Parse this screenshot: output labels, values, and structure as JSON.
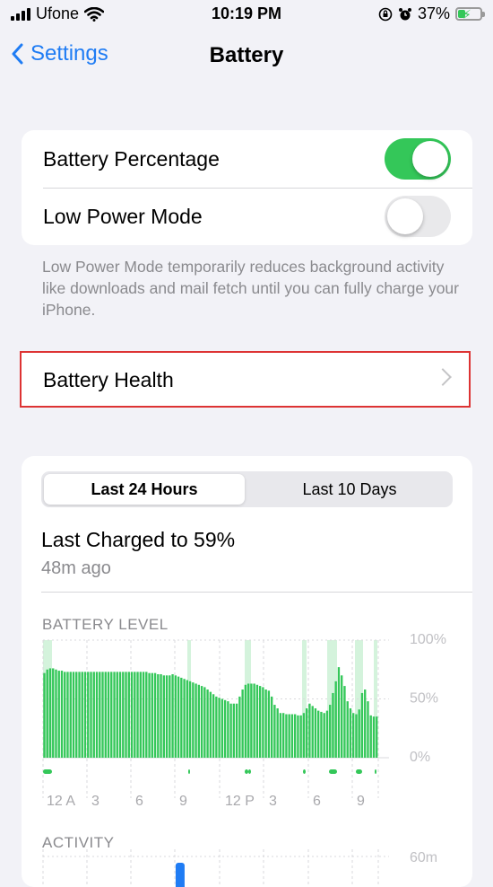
{
  "status": {
    "carrier": "Ufone",
    "time": "10:19 PM",
    "battery_pct": "37%"
  },
  "nav": {
    "back_label": "Settings",
    "title": "Battery"
  },
  "settings": {
    "battery_percentage": {
      "label": "Battery Percentage",
      "on": true
    },
    "low_power_mode": {
      "label": "Low Power Mode",
      "on": false
    },
    "footnote": "Low Power Mode temporarily reduces background activity like downloads and mail fetch until you can fully charge your iPhone."
  },
  "battery_health": {
    "label": "Battery Health"
  },
  "usage": {
    "tabs": [
      "Last 24 Hours",
      "Last 10 Days"
    ],
    "selected_tab": 0,
    "last_charged": "Last Charged to 59%",
    "last_charged_ago": "48m ago",
    "battery_level_title": "BATTERY LEVEL",
    "activity_title": "ACTIVITY",
    "activity_top_label": "60m"
  },
  "colors": {
    "accent": "#1f7cf4",
    "green": "#34c759",
    "charging_band": "#d4f3dc"
  },
  "chart_data": [
    {
      "type": "bar",
      "title": "BATTERY LEVEL",
      "ylabel": "",
      "ylim": [
        0,
        100
      ],
      "y_ticks": [
        "100%",
        "50%",
        "0%"
      ],
      "x_tick_labels": [
        "12 A",
        "3",
        "6",
        "9",
        "12 P",
        "3",
        "6",
        "9"
      ],
      "grid": true,
      "series": [
        {
          "values": [
            72,
            75,
            76,
            76,
            75,
            74,
            74,
            73,
            73,
            73,
            73,
            73,
            73,
            73,
            73,
            73,
            73,
            73,
            73,
            73,
            73,
            73,
            73,
            73,
            73,
            73,
            73,
            73,
            73,
            73,
            73,
            73,
            73,
            73,
            73,
            73,
            72,
            72,
            72,
            71,
            71,
            70,
            70,
            70,
            71,
            70,
            69,
            68,
            67,
            66,
            65,
            64,
            63,
            62,
            61,
            60,
            58,
            56,
            54,
            52,
            51,
            50,
            49,
            48,
            46,
            46,
            46,
            52,
            58,
            62,
            63,
            63,
            63,
            62,
            61,
            60,
            58,
            57,
            52,
            45,
            42,
            38,
            38,
            37,
            37,
            37,
            37,
            36,
            36,
            38,
            42,
            46,
            44,
            42,
            40,
            39,
            38,
            40,
            45,
            55,
            65,
            77,
            70,
            61,
            48,
            42,
            38,
            37,
            41,
            55,
            58,
            48,
            36,
            35,
            35
          ]
        }
      ],
      "charging_markers": true
    },
    {
      "type": "bar",
      "title": "ACTIVITY",
      "y_ticks": [
        "60m"
      ],
      "series": [
        {
          "values": [
            0,
            0,
            0,
            0,
            0,
            0,
            0,
            0,
            0,
            0,
            0,
            0,
            0,
            0,
            0,
            0,
            0,
            0,
            0,
            0,
            0,
            0,
            0,
            0,
            0,
            0,
            0,
            0,
            0,
            0,
            0,
            0,
            0,
            0,
            0,
            0,
            0,
            0,
            0,
            0,
            0,
            0,
            0,
            0,
            0,
            0,
            0,
            0,
            0,
            0,
            0,
            0,
            0,
            0,
            0,
            0,
            0,
            0,
            0,
            0,
            0,
            0,
            0,
            0,
            0,
            0,
            0,
            0,
            0,
            0,
            0,
            0,
            0,
            0,
            0,
            0,
            0,
            0,
            0,
            0,
            0,
            0,
            0,
            0,
            0,
            0,
            0,
            0,
            0,
            0,
            0,
            0,
            0,
            0,
            0,
            0,
            0,
            0,
            0,
            0,
            0,
            0,
            0,
            0,
            0,
            0,
            0,
            0,
            0,
            0,
            0,
            0,
            0,
            0,
            0,
            0
          ]
        }
      ],
      "highlight_bars": [
        {
          "slot": 3,
          "label": ""
        },
        {
          "slot": 16,
          "label": ""
        }
      ]
    }
  ]
}
